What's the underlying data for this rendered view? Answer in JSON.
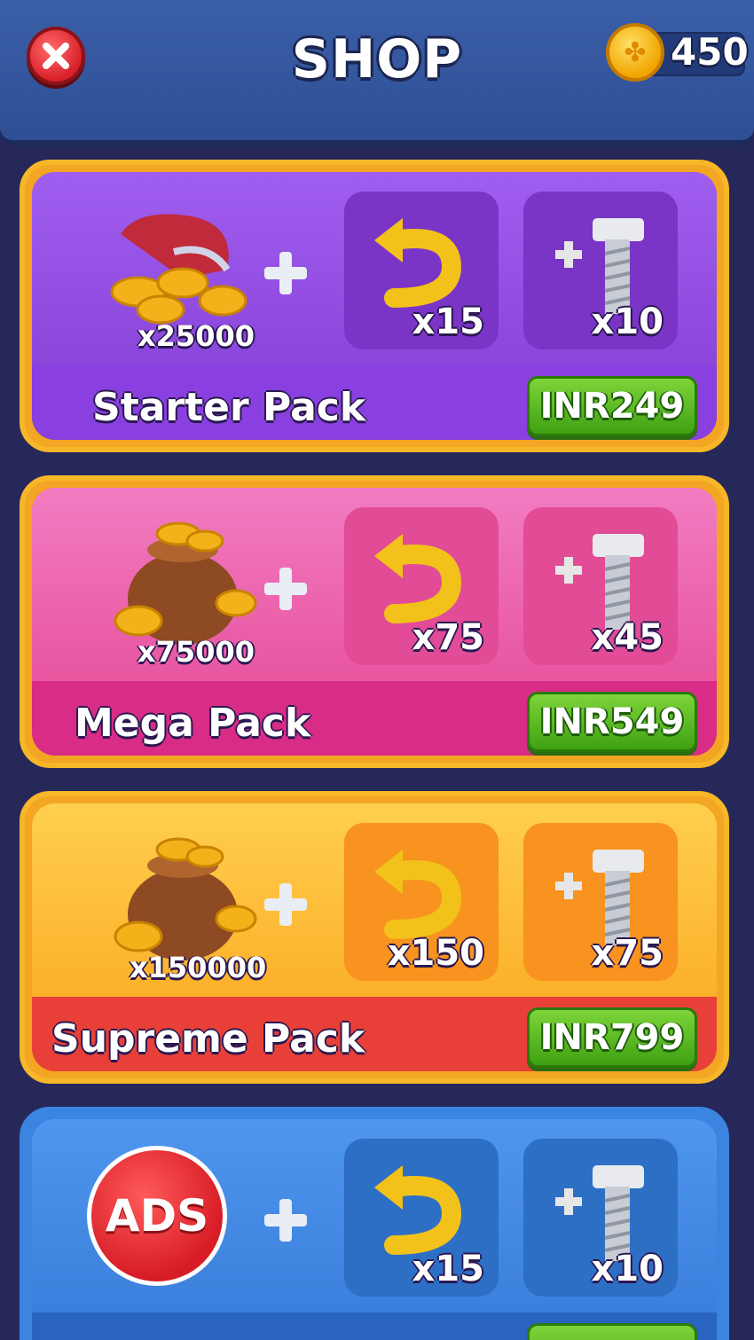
{
  "header": {
    "title": "SHOP",
    "coin_balance": "450"
  },
  "packs": [
    {
      "name": "Starter Pack",
      "coins": "x25000",
      "undo_qty": "x15",
      "screw_qty": "x10",
      "price": "INR249"
    },
    {
      "name": "Mega Pack",
      "coins": "x75000",
      "undo_qty": "x75",
      "screw_qty": "x45",
      "price": "INR549"
    },
    {
      "name": "Supreme Pack",
      "coins": "x150000",
      "undo_qty": "x150",
      "screw_qty": "x75",
      "price": "INR799"
    }
  ],
  "ads_pack": {
    "label": "ADS",
    "undo_qty": "x15",
    "screw_qty": "x10"
  },
  "colors": {
    "starter": "#8e4ce0",
    "mega": "#ea5fb0",
    "supreme": "#fbb83c",
    "ads": "#3b84e0",
    "price_button": "#4fb51c"
  }
}
